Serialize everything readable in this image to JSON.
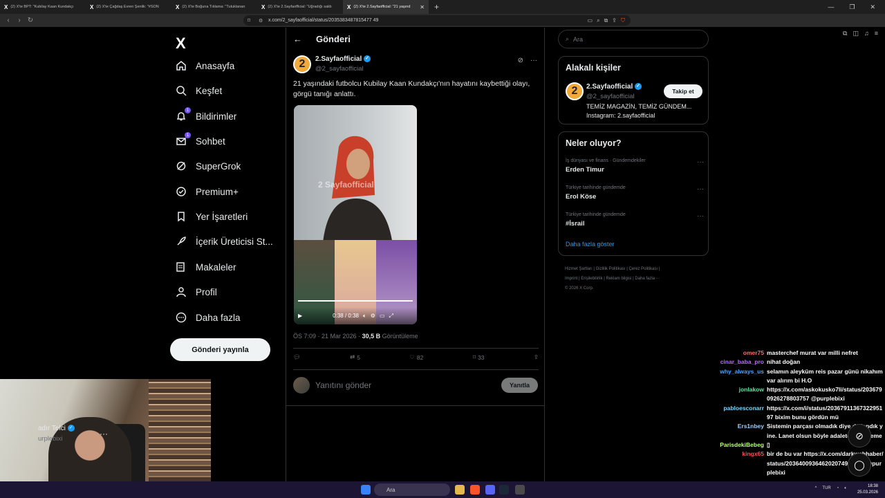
{
  "browser": {
    "tabs": [
      {
        "title": "(2) X'te BPT: \"Kubilay Kaan Kundakçı"
      },
      {
        "title": "(2) X'te Çağdaş Evren Şenlik: \"#SON"
      },
      {
        "title": "(2) X'te Boğuna Tıklama: \"Tutuklanan"
      },
      {
        "title": "(2) X'te 2.Sayfaofficial: \"Uğradığı saldı"
      },
      {
        "title": "(2) X'te 2.Sayfaofficial: \"21 yaşınd"
      }
    ],
    "url": "x.com/2_sayfaofficial/status/2035383487815477 49"
  },
  "nav": {
    "logo": "X",
    "items": [
      {
        "label": "Anasayfa",
        "icon": "home-icon"
      },
      {
        "label": "Keşfet",
        "icon": "search-icon"
      },
      {
        "label": "Bildirimler",
        "icon": "bell-icon",
        "badge": "1"
      },
      {
        "label": "Sohbet",
        "icon": "mail-icon",
        "badge": "1"
      },
      {
        "label": "SuperGrok",
        "icon": "grok-icon"
      },
      {
        "label": "Premium+",
        "icon": "premium-icon"
      },
      {
        "label": "Yer İşaretleri",
        "icon": "bookmark-icon"
      },
      {
        "label": "İçerik Üreticisi St...",
        "icon": "rocket-icon"
      },
      {
        "label": "Makaleler",
        "icon": "article-icon"
      },
      {
        "label": "Profil",
        "icon": "person-icon"
      },
      {
        "label": "Daha fazla",
        "icon": "more-circle-icon"
      }
    ],
    "post_button": "Gönderi yayınla",
    "me_name": "adır Telci",
    "me_handle": "urplebixi"
  },
  "post": {
    "header": "Gönderi",
    "author_name": "2.Sayfaofficial",
    "author_handle": "@2_sayfaofficial",
    "avatar_text": "2",
    "text": "21 yaşındaki futbolcu Kubilay Kaan Kundakçı'nın hayatını kaybettiği olayı, görgü tanığı anlattı.",
    "watermark": "2 Sayfaofficial",
    "video_time": "0:38 / 0:38",
    "video_progress": 1.0,
    "time": "ÖS 7:09 · 21 Mar 2026 · ",
    "views_count": "30,5 B",
    "views_label": " Görüntüleme",
    "reposts": "5",
    "likes": "82",
    "bookmarks": "33",
    "reply_placeholder": "Yanıtını gönder",
    "reply_button": "Yanıtla"
  },
  "right": {
    "search_placeholder": "Ara",
    "related_title": "Alakalı kişiler",
    "rel_name": "2.Sayfaofficial",
    "rel_handle": "@2_sayfaofficial",
    "rel_bio1": "TEMİZ MAGAZİN, TEMİZ GÜNDEM...",
    "rel_bio2": "Instagram: 2.sayfaofficial",
    "follow": "Takip et",
    "trends_title": "Neler oluyor?",
    "trends": [
      {
        "category": "İş dünyası ve finans · Gündemdekiler",
        "title": "Erden Timur"
      },
      {
        "category": "Türkiye tarihinde gündemde",
        "title": "Erol Köse"
      },
      {
        "category": "Türkiye tarihinde gündemde",
        "title": "#İsrail"
      }
    ],
    "show_more": "Daha fazla göster",
    "footer1": "Hizmet Şartları  |  Gizlilik Politikası  |  Çerez Politikası  |",
    "footer2": "Imprint  |  Erişilebilirlik  |  Reklam bilgisi  |  Daha fazla ···",
    "footer3": "© 2026 X Corp."
  },
  "chat": [
    {
      "user": "omer75",
      "color": "#ff6b6b",
      "msg": "masterchef murat var milli nefret"
    },
    {
      "user": "cinar_baba_pro",
      "color": "#b96bff",
      "msg": "nihat doğan"
    },
    {
      "user": "why_always_us",
      "color": "#4aa3ff",
      "msg": "selamın aleyküm reis pazar günü nikahım var alırım bi H.O"
    },
    {
      "user": "jonlakow",
      "color": "#5ee3a2",
      "msg": "https://x.com/askokusko7li/status/2036790926278803757 @purplebixi"
    },
    {
      "user": "pabloesconarr",
      "color": "#7ad7ff",
      "msg": "https://x.com/i/status/2036791136732295197 bixim bunu gördün mü"
    },
    {
      "user": "Ers1nbey",
      "color": "#9ad0ff",
      "msg": "Sistemin parçası olmadık diye dışlandık yine. Lanet olsun böyle adalete ve sisteme"
    },
    {
      "user": "ParisdekiBebeg",
      "color": "#b7ff7a",
      "msg": "▯"
    },
    {
      "user": "kingx65",
      "color": "#ff4d4d",
      "msg": "bir de bu var https://x.com/darkwebhaber/status/2036400936462020749?s=46 @purplebixi"
    }
  ],
  "taskbar": {
    "search": "Ara",
    "lang": "TUR",
    "time": "18:38",
    "date": "25.03.2026"
  }
}
